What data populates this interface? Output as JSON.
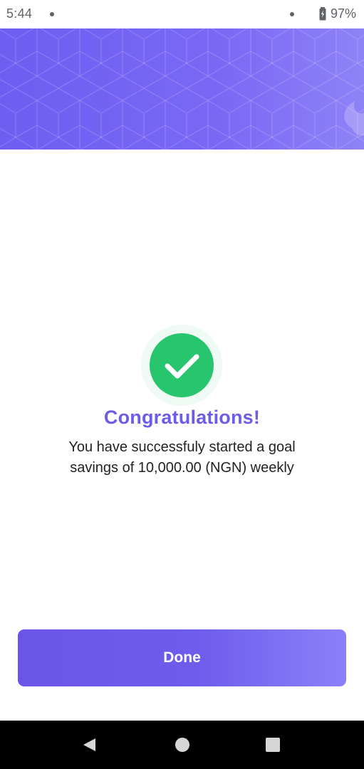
{
  "status_bar": {
    "time": "5:44",
    "battery": "97%",
    "icons": [
      "notification-dot-icon",
      "wifi-dot-icon",
      "battery-charging-icon"
    ]
  },
  "banner": {
    "pattern": "hexagon-cube-pattern",
    "colors": [
      "#6f5df2",
      "#8f82f7"
    ]
  },
  "success": {
    "icon": "checkmark-icon",
    "color": "#27c66e",
    "title": "Congratulations!",
    "message": "You have successfuly started a goal savings of 10,000.00 (NGN) weekly"
  },
  "actions": {
    "done_label": "Done"
  },
  "navigation": {
    "icons": [
      "back-icon",
      "home-icon",
      "recents-icon"
    ]
  },
  "theme": {
    "accent": "#6c5ce7",
    "success": "#27c66e"
  }
}
